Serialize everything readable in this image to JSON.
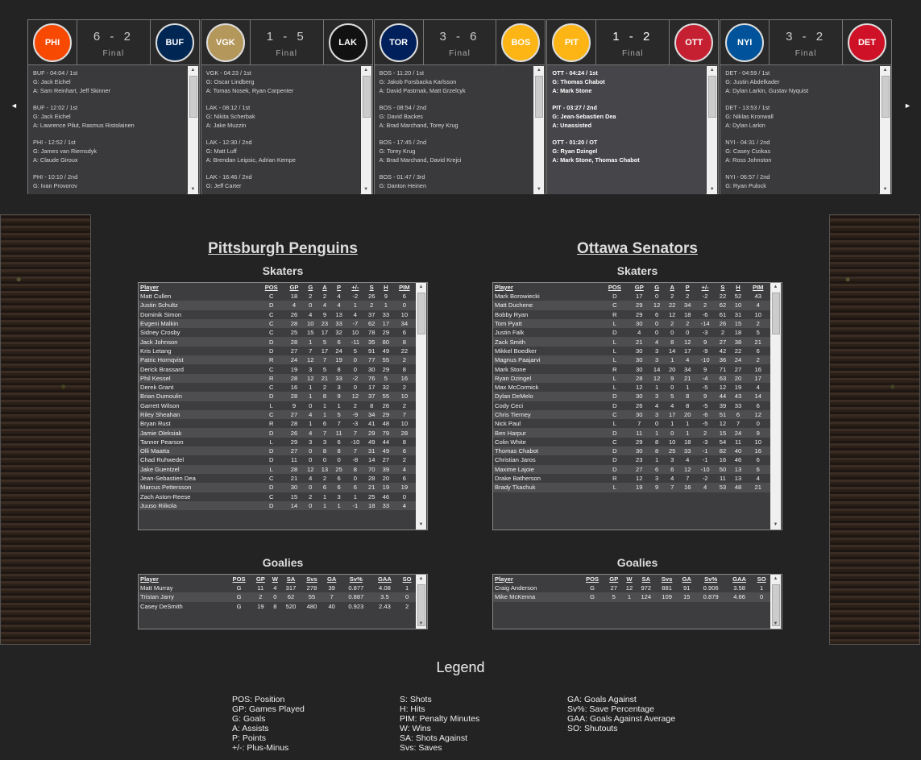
{
  "nav": {
    "prev": "◄",
    "next": "►"
  },
  "games": [
    {
      "away": "PHI",
      "home": "BUF",
      "score": "6 - 2",
      "status": "Final",
      "away_color": "#f74902",
      "home_color": "#002654",
      "events": [
        {
          "line1": "BUF - 04:04 / 1st",
          "line2": "G: Jack Eichel",
          "line3": "A: Sam Reinhart, Jeff Skinner"
        },
        {
          "line1": "BUF - 12:02 / 1st",
          "line2": "G: Jack Eichel",
          "line3": "A: Lawrence Pilut, Rasmus Ristolainen"
        },
        {
          "line1": "PHI - 12:52 / 1st",
          "line2": "G: James van Riemsdyk",
          "line3": "A: Claude Giroux"
        },
        {
          "line1": "PHI - 10:10 / 2nd",
          "line2": "G: Ivan Provorov",
          "line3": ""
        }
      ]
    },
    {
      "away": "VGK",
      "home": "LAK",
      "score": "1 - 5",
      "status": "Final",
      "away_color": "#b4975a",
      "home_color": "#111111",
      "events": [
        {
          "line1": "VGK - 04:23 / 1st",
          "line2": "G: Oscar Lindberg",
          "line3": "A: Tomas Nosek, Ryan Carpenter"
        },
        {
          "line1": "LAK - 08:12 / 1st",
          "line2": "G: Nikita Scherbak",
          "line3": "A: Jake Muzzin"
        },
        {
          "line1": "LAK - 12:30 / 2nd",
          "line2": "G: Matt Luff",
          "line3": "A: Brendan Leipsic, Adrian Kempe"
        },
        {
          "line1": "LAK - 16:46 / 2nd",
          "line2": "G: Jeff Carter",
          "line3": ""
        }
      ]
    },
    {
      "away": "TOR",
      "home": "BOS",
      "score": "3 - 6",
      "status": "Final",
      "away_color": "#00205b",
      "home_color": "#fcb514",
      "events": [
        {
          "line1": "BOS - 11:20 / 1st",
          "line2": "G: Jakob Forsbacka Karlsson",
          "line3": "A: David Pastrnak, Matt Grzelcyk"
        },
        {
          "line1": "BOS - 08:54 / 2nd",
          "line2": "G: David Backes",
          "line3": "A: Brad Marchand, Torey Krug"
        },
        {
          "line1": "BOS - 17:45 / 2nd",
          "line2": "G: Torey Krug",
          "line3": "A: Brad Marchand, David Krejci"
        },
        {
          "line1": "BOS - 01:47 / 3rd",
          "line2": "G: Danton Heinen",
          "line3": ""
        }
      ]
    },
    {
      "away": "PIT",
      "home": "OTT",
      "score": "1 - 2",
      "status": "Final",
      "away_color": "#fcb514",
      "home_color": "#c52032",
      "events": [
        {
          "line1": "OTT - 04:24 / 1st",
          "line2": "G: Thomas Chabot",
          "line3": "A: Mark Stone"
        },
        {
          "line1": "PIT - 03:27 / 2nd",
          "line2": "G: Jean-Sebastien Dea",
          "line3": "A: Unassisted"
        },
        {
          "line1": "OTT - 01:20 / OT",
          "line2": "G: Ryan Dzingel",
          "line3": "A: Mark Stone, Thomas Chabot"
        }
      ]
    },
    {
      "away": "NYI",
      "home": "DET",
      "score": "3 - 2",
      "status": "Final",
      "away_color": "#00539b",
      "home_color": "#ce1126",
      "events": [
        {
          "line1": "DET - 04:59 / 1st",
          "line2": "G: Justin Abdelkader",
          "line3": "A: Dylan Larkin, Gustav Nyquist"
        },
        {
          "line1": "DET - 13:53 / 1st",
          "line2": "G: Niklas Kronwall",
          "line3": "A: Dylan Larkin"
        },
        {
          "line1": "NYI - 04:31 / 2nd",
          "line2": "G: Casey Cizikas",
          "line3": "A: Ross Johnston"
        },
        {
          "line1": "NYI - 06:57 / 2nd",
          "line2": "G: Ryan Pulock",
          "line3": ""
        }
      ]
    }
  ],
  "skater_headers": [
    "Player",
    "POS",
    "GP",
    "G",
    "A",
    "P",
    "+/-",
    "S",
    "H",
    "PIM"
  ],
  "goalie_headers": [
    "Player",
    "POS",
    "GP",
    "W",
    "SA",
    "Svs",
    "GA",
    "Sv%",
    "GAA",
    "SO"
  ],
  "labels": {
    "skaters": "Skaters",
    "goalies": "Goalies"
  },
  "left_team": {
    "name": "Pittsburgh Penguins",
    "skaters": [
      [
        "Matt Cullen",
        "C",
        "18",
        "2",
        "2",
        "4",
        "-2",
        "26",
        "9",
        "6"
      ],
      [
        "Justin Schultz",
        "D",
        "4",
        "0",
        "4",
        "4",
        "1",
        "2",
        "1",
        "0"
      ],
      [
        "Dominik Simon",
        "C",
        "26",
        "4",
        "9",
        "13",
        "4",
        "37",
        "33",
        "10"
      ],
      [
        "Evgeni Malkin",
        "C",
        "28",
        "10",
        "23",
        "33",
        "-7",
        "62",
        "17",
        "34"
      ],
      [
        "Sidney Crosby",
        "C",
        "25",
        "15",
        "17",
        "32",
        "10",
        "78",
        "29",
        "6"
      ],
      [
        "Jack Johnson",
        "D",
        "28",
        "1",
        "5",
        "6",
        "-11",
        "35",
        "80",
        "8"
      ],
      [
        "Kris Letang",
        "D",
        "27",
        "7",
        "17",
        "24",
        "5",
        "91",
        "49",
        "22"
      ],
      [
        "Patric Hornqvist",
        "R",
        "24",
        "12",
        "7",
        "19",
        "0",
        "77",
        "55",
        "2"
      ],
      [
        "Derick Brassard",
        "C",
        "19",
        "3",
        "5",
        "8",
        "0",
        "30",
        "29",
        "8"
      ],
      [
        "Phil Kessel",
        "R",
        "28",
        "12",
        "21",
        "33",
        "-2",
        "76",
        "5",
        "16"
      ],
      [
        "Derek Grant",
        "C",
        "16",
        "1",
        "2",
        "3",
        "0",
        "17",
        "32",
        "2"
      ],
      [
        "Brian Dumoulin",
        "D",
        "28",
        "1",
        "8",
        "9",
        "12",
        "37",
        "55",
        "10"
      ],
      [
        "Garrett Wilson",
        "L",
        "9",
        "0",
        "1",
        "1",
        "2",
        "8",
        "26",
        "2"
      ],
      [
        "Riley Sheahan",
        "C",
        "27",
        "4",
        "1",
        "5",
        "-9",
        "34",
        "29",
        "7"
      ],
      [
        "Bryan Rust",
        "R",
        "28",
        "1",
        "6",
        "7",
        "-3",
        "41",
        "48",
        "10"
      ],
      [
        "Jamie Oleksiak",
        "D",
        "26",
        "4",
        "7",
        "11",
        "7",
        "29",
        "79",
        "28"
      ],
      [
        "Tanner Pearson",
        "L",
        "29",
        "3",
        "3",
        "6",
        "-10",
        "49",
        "44",
        "8"
      ],
      [
        "Olli Maatta",
        "D",
        "27",
        "0",
        "8",
        "8",
        "7",
        "31",
        "49",
        "6"
      ],
      [
        "Chad Ruhwedel",
        "D",
        "11",
        "0",
        "0",
        "0",
        "-8",
        "14",
        "27",
        "2"
      ],
      [
        "Jake Guentzel",
        "L",
        "28",
        "12",
        "13",
        "25",
        "8",
        "70",
        "39",
        "4"
      ],
      [
        "Jean-Sebastien Dea",
        "C",
        "21",
        "4",
        "2",
        "6",
        "0",
        "28",
        "20",
        "6"
      ],
      [
        "Marcus Pettersson",
        "D",
        "30",
        "0",
        "6",
        "6",
        "6",
        "21",
        "19",
        "19"
      ],
      [
        "Zach Aston-Reese",
        "C",
        "15",
        "2",
        "1",
        "3",
        "1",
        "25",
        "46",
        "0"
      ],
      [
        "Juuso Riikola",
        "D",
        "14",
        "0",
        "1",
        "1",
        "-1",
        "18",
        "33",
        "4"
      ]
    ],
    "goalies": [
      [
        "Matt Murray",
        "G",
        "11",
        "4",
        "317",
        "278",
        "39",
        "0.877",
        "4.08",
        "1"
      ],
      [
        "Tristan Jarry",
        "G",
        "2",
        "0",
        "62",
        "55",
        "7",
        "0.887",
        "3.5",
        "0"
      ],
      [
        "Casey DeSmith",
        "G",
        "19",
        "8",
        "520",
        "480",
        "40",
        "0.923",
        "2.43",
        "2"
      ]
    ]
  },
  "right_team": {
    "name": "Ottawa Senators",
    "skaters": [
      [
        "Mark Borowiecki",
        "D",
        "17",
        "0",
        "2",
        "2",
        "-2",
        "22",
        "52",
        "43"
      ],
      [
        "Matt Duchene",
        "C",
        "29",
        "12",
        "22",
        "34",
        "2",
        "62",
        "10",
        "4"
      ],
      [
        "Bobby Ryan",
        "R",
        "29",
        "6",
        "12",
        "18",
        "-6",
        "61",
        "31",
        "10"
      ],
      [
        "Tom Pyatt",
        "L",
        "30",
        "0",
        "2",
        "2",
        "-14",
        "26",
        "15",
        "2"
      ],
      [
        "Justin Falk",
        "D",
        "4",
        "0",
        "0",
        "0",
        "-3",
        "2",
        "18",
        "5"
      ],
      [
        "Zack Smith",
        "L",
        "21",
        "4",
        "8",
        "12",
        "9",
        "27",
        "38",
        "21"
      ],
      [
        "Mikkel Boedker",
        "L",
        "30",
        "3",
        "14",
        "17",
        "-9",
        "42",
        "22",
        "6"
      ],
      [
        "Magnus Paajarvi",
        "L",
        "30",
        "3",
        "1",
        "4",
        "-10",
        "36",
        "24",
        "2"
      ],
      [
        "Mark Stone",
        "R",
        "30",
        "14",
        "20",
        "34",
        "9",
        "71",
        "27",
        "16"
      ],
      [
        "Ryan Dzingel",
        "L",
        "28",
        "12",
        "9",
        "21",
        "-4",
        "63",
        "20",
        "17"
      ],
      [
        "Max McCormick",
        "L",
        "12",
        "1",
        "0",
        "1",
        "-5",
        "12",
        "19",
        "4"
      ],
      [
        "Dylan DeMelo",
        "D",
        "30",
        "3",
        "5",
        "8",
        "9",
        "44",
        "43",
        "14"
      ],
      [
        "Cody Ceci",
        "D",
        "26",
        "4",
        "4",
        "8",
        "-5",
        "39",
        "33",
        "6"
      ],
      [
        "Chris Tierney",
        "C",
        "30",
        "3",
        "17",
        "20",
        "-6",
        "51",
        "6",
        "12"
      ],
      [
        "Nick Paul",
        "L",
        "7",
        "0",
        "1",
        "1",
        "-5",
        "12",
        "7",
        "0"
      ],
      [
        "Ben Harpur",
        "D",
        "11",
        "1",
        "0",
        "1",
        "2",
        "15",
        "24",
        "9"
      ],
      [
        "Colin White",
        "C",
        "29",
        "8",
        "10",
        "18",
        "-3",
        "54",
        "11",
        "10"
      ],
      [
        "Thomas Chabot",
        "D",
        "30",
        "8",
        "25",
        "33",
        "-1",
        "82",
        "40",
        "16"
      ],
      [
        "Christian Jaros",
        "D",
        "23",
        "1",
        "3",
        "4",
        "-1",
        "16",
        "46",
        "6"
      ],
      [
        "Maxime Lajoie",
        "D",
        "27",
        "6",
        "6",
        "12",
        "-10",
        "50",
        "13",
        "6"
      ],
      [
        "Drake Batherson",
        "R",
        "12",
        "3",
        "4",
        "7",
        "-2",
        "11",
        "13",
        "4"
      ],
      [
        "Brady Tkachuk",
        "L",
        "19",
        "9",
        "7",
        "16",
        "4",
        "53",
        "48",
        "21"
      ]
    ],
    "goalies": [
      [
        "Craig Anderson",
        "G",
        "27",
        "12",
        "972",
        "881",
        "91",
        "0.906",
        "3.58",
        "1"
      ],
      [
        "Mike McKenna",
        "G",
        "5",
        "1",
        "124",
        "109",
        "15",
        "0.879",
        "4.66",
        "0"
      ]
    ]
  },
  "legend": {
    "title": "Legend",
    "col1": [
      "POS: Position",
      "GP: Games Played",
      "G: Goals",
      "A: Assists",
      "P: Points",
      "+/-: Plus-Minus"
    ],
    "col2": [
      "S: Shots",
      "H: Hits",
      "PIM: Penalty Minutes",
      "W: Wins",
      "SA: Shots Against",
      "Svs: Saves"
    ],
    "col3": [
      "GA: Goals Against",
      "Sv%: Save Percentage",
      "GAA: Goals Against Average",
      "SO: Shutouts"
    ]
  }
}
